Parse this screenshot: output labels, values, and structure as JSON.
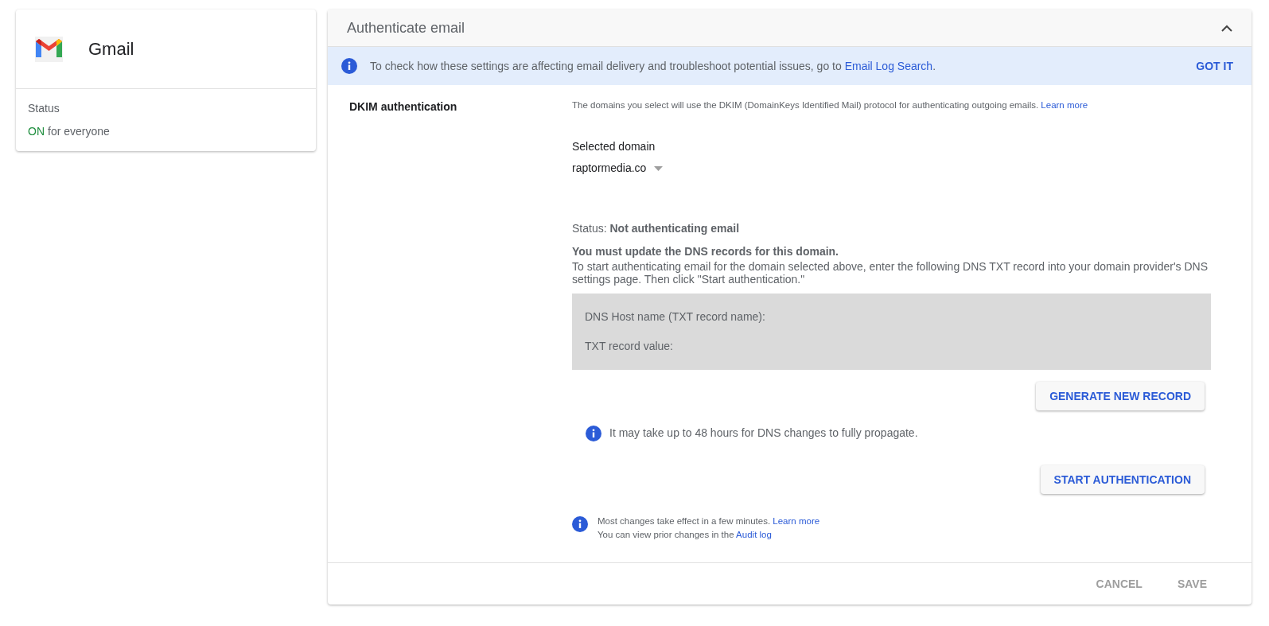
{
  "app_card": {
    "title": "Gmail",
    "status_label": "Status",
    "status_value": "ON",
    "status_on": true,
    "status_scope": "for everyone"
  },
  "panel": {
    "title": "Authenticate email",
    "expanded": true,
    "banner": {
      "text": "To check how these settings are affecting email delivery and troubleshoot potential issues, go to ",
      "link": "Email Log Search",
      "after": ".",
      "dismiss": "GOT IT"
    },
    "section_label": "DKIM authentication",
    "description": {
      "text": "The domains you select will use the DKIM (DomainKeys Identified Mail) protocol for authenticating outgoing emails. ",
      "link": "Learn more"
    },
    "domain_label": "Selected domain",
    "domain_value": "raptormedia.co",
    "status": "Status: **Not authenticating email**",
    "warning_title": "You must update the DNS records for this domain.",
    "warning_text": "To start authenticating email for the domain selected above, enter the following DNS TXT record into your domain provider's DNS settings page. Then click \"Start authentication.\"",
    "record_fields": [
      "DNS Host name (TXT record name):",
      "TXT record value:"
    ],
    "generate_button": "GENERATE NEW RECORD",
    "propagate_note": "It may take up to 48 hours for DNS changes to fully propagate.",
    "start_button": "START AUTHENTICATION",
    "notes": [
      {
        "text": "Most changes take effect in a few minutes. ",
        "link": "Learn more"
      },
      {
        "text": "You can view prior changes in the ",
        "link": "Audit log"
      }
    ],
    "actions": [
      {
        "label": "CANCEL",
        "disabled": true
      },
      {
        "label": "SAVE",
        "disabled": true
      }
    ]
  }
}
